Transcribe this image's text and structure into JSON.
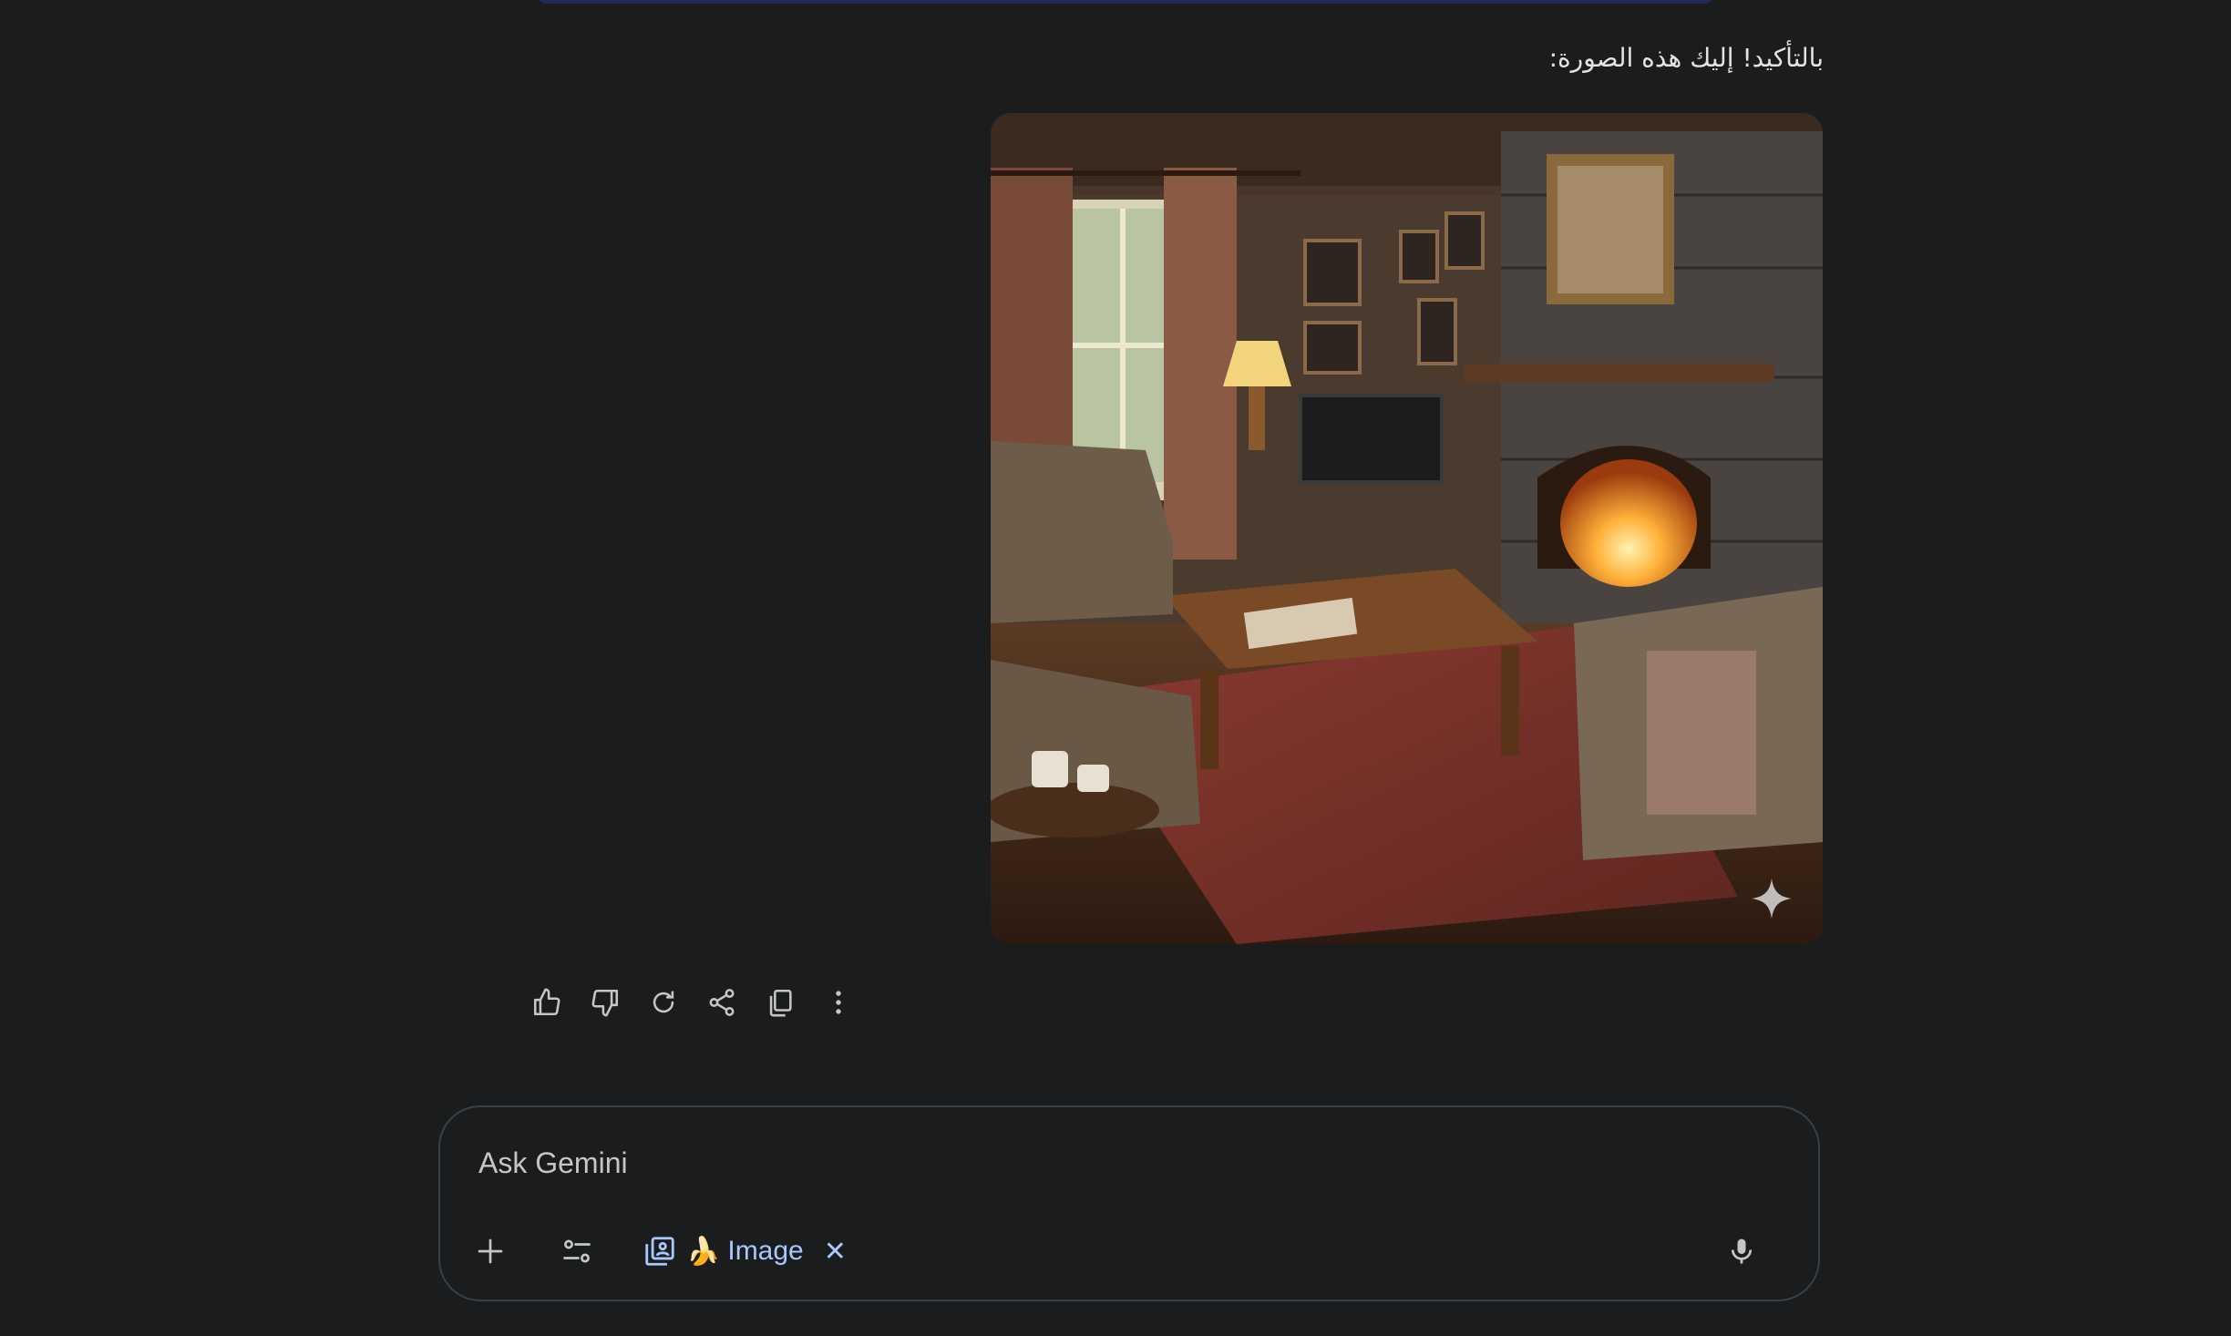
{
  "response": {
    "text": "بالتأكيد! إليك هذه الصورة:",
    "image_alt_icon": "sparkle-icon"
  },
  "actions": [
    {
      "name": "thumbs-up-icon"
    },
    {
      "name": "thumbs-down-icon"
    },
    {
      "name": "regenerate-icon"
    },
    {
      "name": "share-icon"
    },
    {
      "name": "copy-icon"
    },
    {
      "name": "more-options-icon"
    }
  ],
  "composer": {
    "placeholder": "Ask Gemini",
    "chip": {
      "emoji": "🍌",
      "label": "Image",
      "close": "✕"
    }
  },
  "colors": {
    "background": "#1b1c1d",
    "accent": "#a8c7fa",
    "border": "#3c4043",
    "text": "#e3e3e3"
  }
}
